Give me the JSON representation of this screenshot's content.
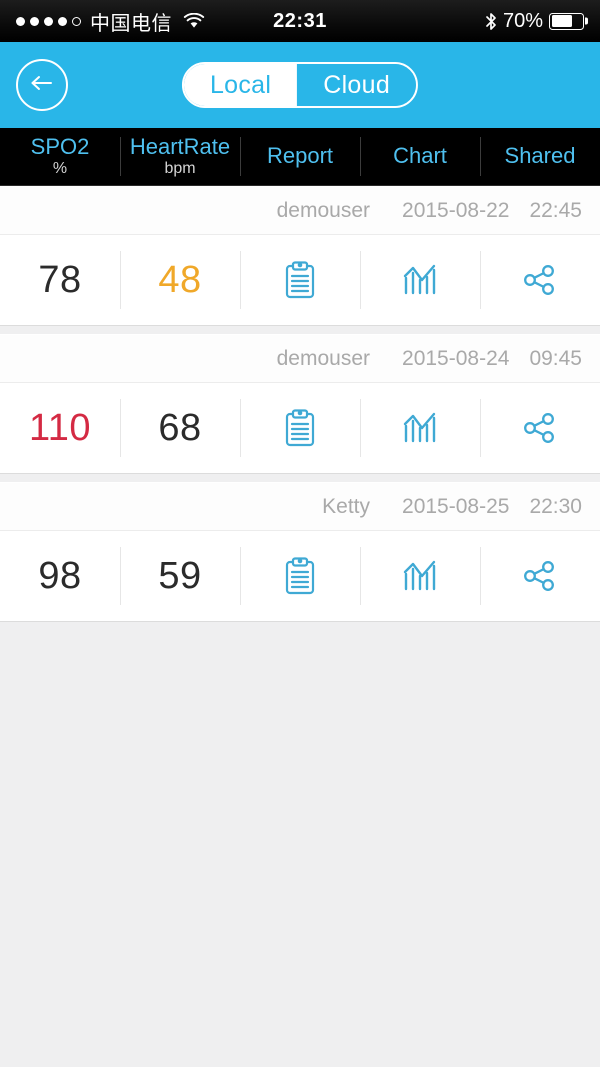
{
  "status_bar": {
    "signal_dots_filled": 4,
    "signal_dots_total": 5,
    "carrier": "中国电信",
    "wifi_icon": "wifi-icon",
    "time": "22:31",
    "bluetooth_icon": "bluetooth-icon",
    "battery_percent": "70%",
    "battery_level": 70
  },
  "navbar": {
    "back_icon": "back-arrow-icon",
    "segments": [
      {
        "label": "Local",
        "selected": true
      },
      {
        "label": "Cloud",
        "selected": false
      }
    ],
    "accent_color": "#29b6e8"
  },
  "table_header": {
    "columns": [
      {
        "title": "SPO2",
        "unit": "%"
      },
      {
        "title": "HeartRate",
        "unit": "bpm"
      },
      {
        "title": "Report",
        "unit": ""
      },
      {
        "title": "Chart",
        "unit": ""
      },
      {
        "title": "Shared",
        "unit": ""
      }
    ],
    "title_color": "#4fc0ef",
    "unit_color": "#d4d4d4",
    "background": "#000000"
  },
  "records": [
    {
      "user": "demouser",
      "date": "2015-08-22",
      "time": "22:45",
      "spo2": "78",
      "spo2_state": "normal",
      "heart_rate": "48",
      "heart_rate_state": "warn",
      "report_icon": "clipboard-icon",
      "chart_icon": "bar-chart-icon",
      "share_icon": "share-icon"
    },
    {
      "user": "demouser",
      "date": "2015-08-24",
      "time": "09:45",
      "spo2": "110",
      "spo2_state": "danger",
      "heart_rate": "68",
      "heart_rate_state": "normal",
      "report_icon": "clipboard-icon",
      "chart_icon": "bar-chart-icon",
      "share_icon": "share-icon"
    },
    {
      "user": "Ketty",
      "date": "2015-08-25",
      "time": "22:30",
      "spo2": "98",
      "spo2_state": "normal",
      "heart_rate": "59",
      "heart_rate_state": "normal",
      "report_icon": "clipboard-icon",
      "chart_icon": "bar-chart-icon",
      "share_icon": "share-icon"
    }
  ],
  "colors": {
    "normal_value": "#2b2b2b",
    "warn_value": "#f0a829",
    "danger_value": "#d42a43",
    "icon_blue": "#3fa9d4",
    "page_background": "#efeff0"
  }
}
